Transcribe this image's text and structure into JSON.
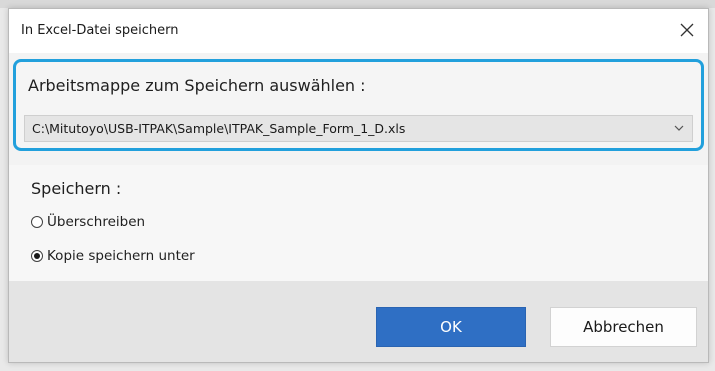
{
  "dialog": {
    "title": "In Excel-Datei speichern"
  },
  "workbook": {
    "label": "Arbeitsmappe zum Speichern auswählen :",
    "selected_path": "C:\\Mitutoyo\\USB-ITPAK\\Sample\\ITPAK_Sample_Form_1_D.xls"
  },
  "save": {
    "label": "Speichern :",
    "options": [
      {
        "label": "Überschreiben",
        "checked": false
      },
      {
        "label": "Kopie speichern unter",
        "checked": true
      }
    ]
  },
  "buttons": {
    "ok_label": "OK",
    "cancel_label": "Abbrechen"
  },
  "colors": {
    "highlight_border": "#22a0dc",
    "primary_button": "#2f6fc4"
  },
  "icons": {
    "close": "close-icon",
    "dropdown": "chevron-down-icon"
  }
}
